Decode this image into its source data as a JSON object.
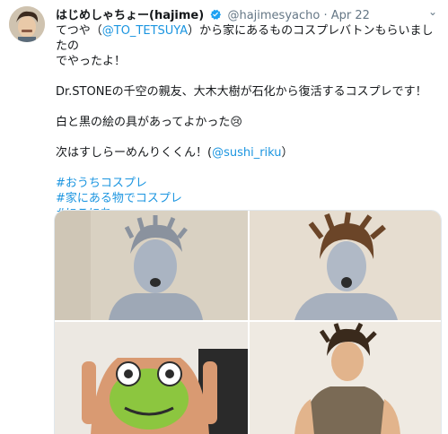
{
  "tweet": {
    "display_name": "はじめしゃちょー(hajime)",
    "handle": "@hajimesyacho",
    "separator": "·",
    "date": "Apr 22",
    "line1_pre": "てつや（",
    "line1_mention": "@TO_TETSUYA",
    "line1_post": "）から家にあるものコスプレバトンもらいましたの",
    "line2": "でやったよ！",
    "line3": "Dr.STONEの千空の親友、大木大樹が石化から復活するコスプレです！",
    "line4": "白と黒の絵の具があってよかった😢",
    "line5_pre": "次はすしらーめんりくくん！(",
    "line5_mention": "@sushi_riku",
    "line5_post": "）",
    "hashtags": [
      "#おうちコスプレ",
      "#家にある物でコスプレ",
      "#にこにち"
    ]
  },
  "colors": {
    "link": "#1b95e0",
    "verified": "#1da1f2",
    "muted": "#657786",
    "text": "#14171a"
  },
  "icons": {
    "verified": "verified-badge-icon",
    "caret": "chevron-down-icon"
  }
}
